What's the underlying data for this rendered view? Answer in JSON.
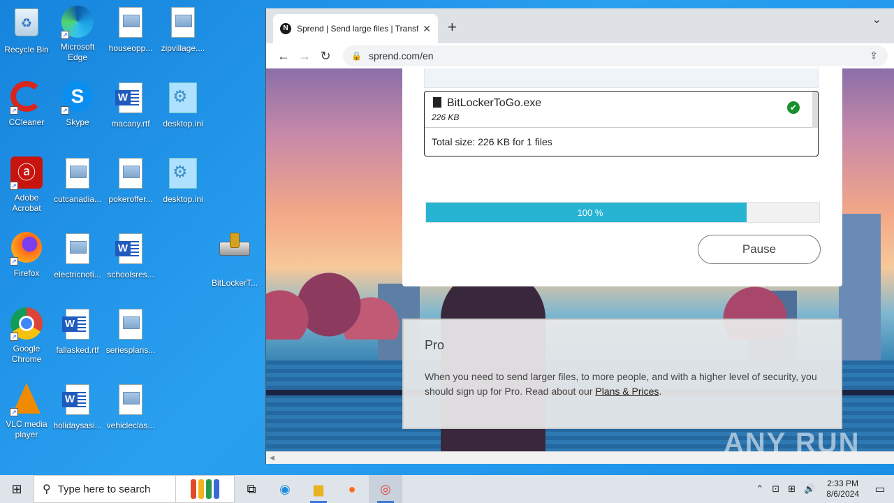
{
  "desktop": {
    "icons": [
      {
        "label": "Recycle Bin"
      },
      {
        "label": "Microsoft Edge"
      },
      {
        "label": "houseopp..."
      },
      {
        "label": "zipvillage...."
      },
      {
        "label": "CCleaner"
      },
      {
        "label": "Skype"
      },
      {
        "label": "macany.rtf"
      },
      {
        "label": "desktop.ini"
      },
      {
        "label": "Adobe Acrobat"
      },
      {
        "label": "cutcanadia..."
      },
      {
        "label": "pokeroffer..."
      },
      {
        "label": "desktop.ini"
      },
      {
        "label": "Firefox"
      },
      {
        "label": "electricnoti..."
      },
      {
        "label": "schoolsres..."
      },
      {
        "label": "BitLockerT..."
      },
      {
        "label": "Google Chrome"
      },
      {
        "label": "fallasked.rtf"
      },
      {
        "label": "seriesplans..."
      },
      {
        "label": "VLC media player"
      },
      {
        "label": "holidaysasi..."
      },
      {
        "label": "vehicleclas..."
      }
    ]
  },
  "browser": {
    "tab": {
      "title": "Sprend | Send large files | Transfer",
      "favicon": "N"
    },
    "url": "sprend.com/en"
  },
  "page": {
    "file": {
      "name": "BitLockerToGo.exe",
      "size": "226 KB"
    },
    "total": "Total size: 226 KB for 1 files",
    "progress": {
      "label": "100 %",
      "fill_fraction": 0.815
    },
    "pause_label": "Pause",
    "pro": {
      "title": "Pro",
      "text_before": "When you need to send larger files, to more people, and with a higher level of security, you should sign up for Pro. Read about our ",
      "link": "Plans & Prices",
      "text_after": "."
    }
  },
  "watermark": "ANY RUN",
  "taskbar": {
    "search_placeholder": "Type here to search",
    "time": "2:33 PM",
    "date": "8/6/2024"
  },
  "colors": {
    "progress": "#27b4d3",
    "check": "#1a8f2e"
  }
}
